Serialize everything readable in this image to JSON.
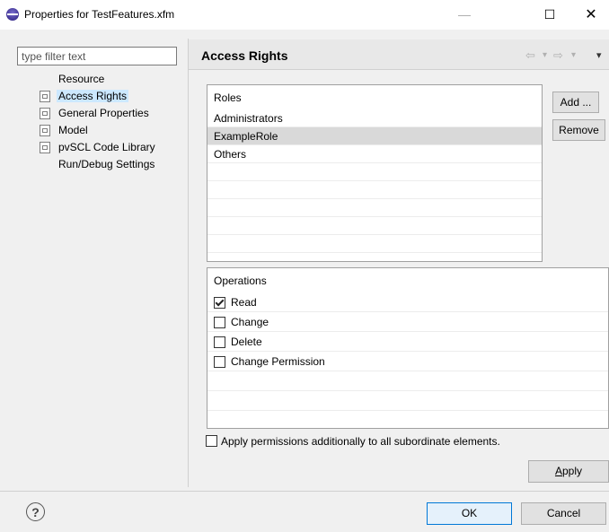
{
  "window": {
    "title": "Properties for TestFeatures.xfm",
    "minimize": "—",
    "maximize": "☐",
    "close": "✕"
  },
  "sidebar": {
    "filter_placeholder": "type filter text",
    "items": [
      {
        "label": "Resource",
        "icon": null
      },
      {
        "label": "Access Rights",
        "icon": "property-page-icon",
        "selected": true
      },
      {
        "label": "General Properties",
        "icon": "property-page-icon"
      },
      {
        "label": "Model",
        "icon": "property-page-icon"
      },
      {
        "label": "pvSCL Code Library",
        "icon": "property-page-icon"
      },
      {
        "label": "Run/Debug Settings",
        "icon": null
      }
    ]
  },
  "header": {
    "title": "Access Rights",
    "back": "⇦",
    "forward": "⇨",
    "dropdown": "▾",
    "menu": "▾"
  },
  "roles": {
    "header": "Roles",
    "rows": [
      "Administrators",
      "ExampleRole",
      "Others"
    ],
    "selected": "ExampleRole",
    "add_label": "Add ...",
    "remove_label": "Remove"
  },
  "operations": {
    "header": "Operations",
    "items": [
      {
        "label": "Read",
        "checked": true
      },
      {
        "label": "Change",
        "checked": false
      },
      {
        "label": "Delete",
        "checked": false
      },
      {
        "label": "Change Permission",
        "checked": false
      }
    ]
  },
  "apply_perm_label": "Apply permissions additionally to all subordinate elements.",
  "apply_label_prefix": "A",
  "apply_label_rest": "pply",
  "footer": {
    "help": "?",
    "ok_label": "OK",
    "cancel_label": "Cancel"
  }
}
